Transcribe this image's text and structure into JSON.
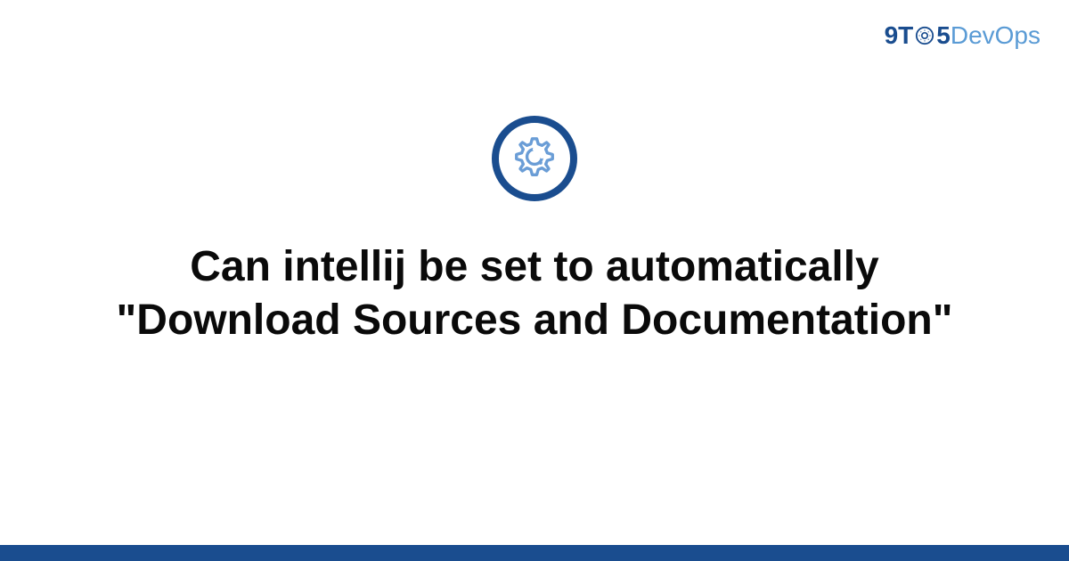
{
  "logo": {
    "part1": "9T",
    "part2": "5",
    "part3": "DevOps"
  },
  "title": "Can intellij be set to automatically \"Download Sources and Documentation\"",
  "colors": {
    "primary": "#1a4d8f",
    "accent": "#5a9bd5"
  }
}
